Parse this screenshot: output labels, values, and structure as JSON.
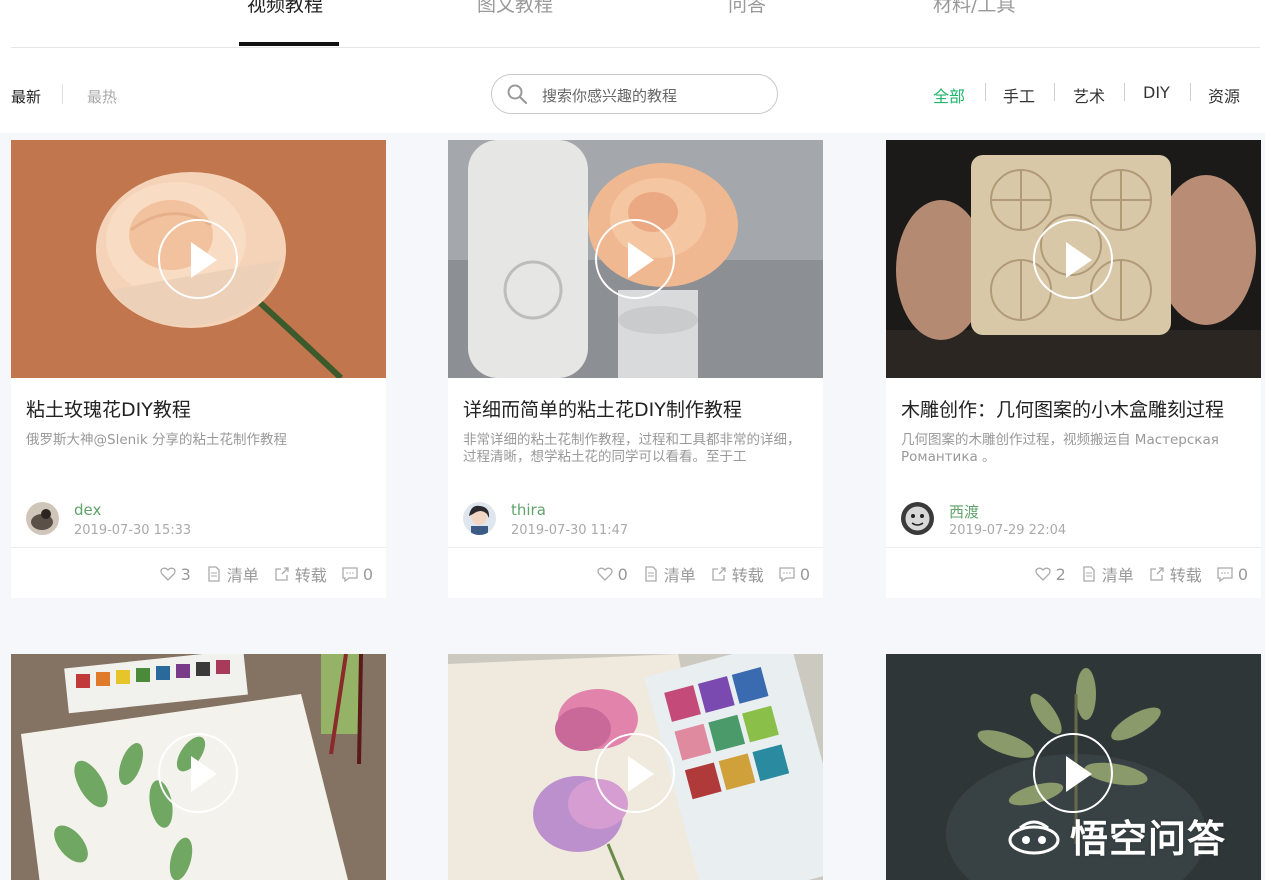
{
  "tabs": [
    {
      "label": "视频教程",
      "active": true
    },
    {
      "label": "图文教程",
      "active": false
    },
    {
      "label": "问答",
      "active": false
    },
    {
      "label": "材料/工具",
      "active": false
    }
  ],
  "sort": {
    "latest": "最新",
    "hottest": "最热"
  },
  "search": {
    "placeholder": "搜索你感兴趣的教程"
  },
  "categories": [
    {
      "label": "全部",
      "active": true
    },
    {
      "label": "手工",
      "active": false
    },
    {
      "label": "艺术",
      "active": false
    },
    {
      "label": "DIY",
      "active": false
    },
    {
      "label": "资源",
      "active": false
    }
  ],
  "colors": {
    "accent": "#1fb56b",
    "author": "#5fa36a"
  },
  "cards": [
    {
      "title": "粘土玫瑰花DIY教程",
      "desc": "俄罗斯大神@Slenik 分享的粘土花制作教程",
      "author": "dex",
      "date": "2019-07-30 15:33",
      "likes": "3",
      "list_label": "清单",
      "share_label": "转载",
      "comments": "0"
    },
    {
      "title": "详细而简单的粘土花DIY制作教程",
      "desc": "非常详细的粘土花制作教程，过程和工具都非常的详细，过程清晰，想学粘土花的同学可以看看。至于工",
      "author": "thira",
      "date": "2019-07-30 11:47",
      "likes": "0",
      "list_label": "清单",
      "share_label": "转载",
      "comments": "0"
    },
    {
      "title": "木雕创作：几何图案的小木盒雕刻过程",
      "desc": "几何图案的木雕创作过程，视频搬运自 Мастерская Романтика 。",
      "author": "西渡",
      "date": "2019-07-29 22:04",
      "likes": "2",
      "list_label": "清单",
      "share_label": "转载",
      "comments": "0"
    }
  ],
  "watermark": {
    "text": "悟空问答"
  }
}
